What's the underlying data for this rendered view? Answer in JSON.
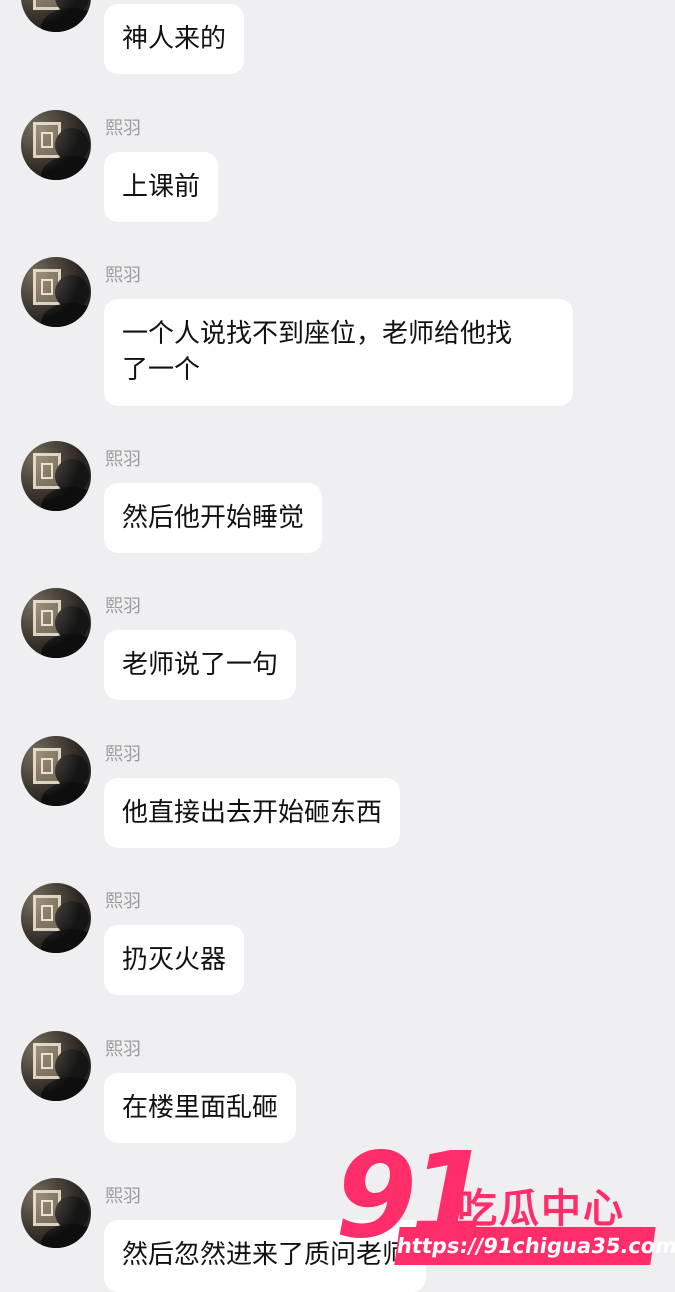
{
  "chat": {
    "sender_name": "熙羽",
    "messages": [
      {
        "text": "神人来的",
        "show_name": false
      },
      {
        "text": "上课前",
        "show_name": true
      },
      {
        "text": "一个人说找不到座位，老师给他找\n了一个",
        "show_name": true
      },
      {
        "text": "然后他开始睡觉",
        "show_name": true
      },
      {
        "text": "老师说了一句",
        "show_name": true
      },
      {
        "text": "他直接出去开始砸东西",
        "show_name": true
      },
      {
        "text": "扔灭火器",
        "show_name": true
      },
      {
        "text": "在楼里面乱砸",
        "show_name": true
      },
      {
        "text": "然后忽然进来了质问老师",
        "show_name": true
      }
    ]
  },
  "watermark": {
    "number": "91",
    "title": "吃瓜中心",
    "url": "https://91chigua35.com",
    "color": "#ff2e6b"
  }
}
